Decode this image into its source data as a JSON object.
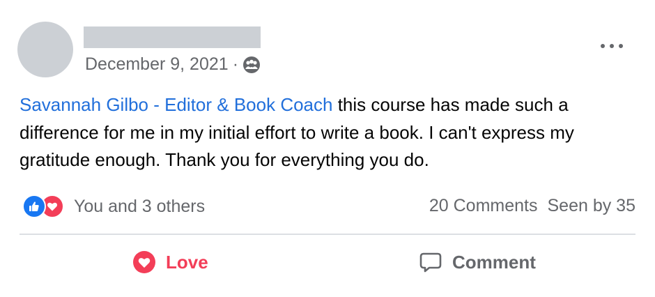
{
  "post": {
    "date": "December 9, 2021",
    "separator": "·",
    "audience_icon": "group-icon",
    "more_icon": "more-options-icon",
    "mention": "Savannah Gilbo - Editor & Book Coach",
    "body": " this course has made such a difference for me in my initial effort to write a book. I can't express my gratitude enough. Thank you for everything you do."
  },
  "reactions": {
    "icons": [
      "like-reaction-icon",
      "love-reaction-icon"
    ],
    "reactors": "You and 3 others",
    "comments": "20 Comments",
    "seen": "Seen by 35"
  },
  "actions": {
    "love_label": "Love",
    "comment_label": "Comment"
  },
  "colors": {
    "link": "#216fdb",
    "love": "#f33e58",
    "like": "#1877f2",
    "muted": "#65676b",
    "placeholder": "#ccd0d5"
  }
}
